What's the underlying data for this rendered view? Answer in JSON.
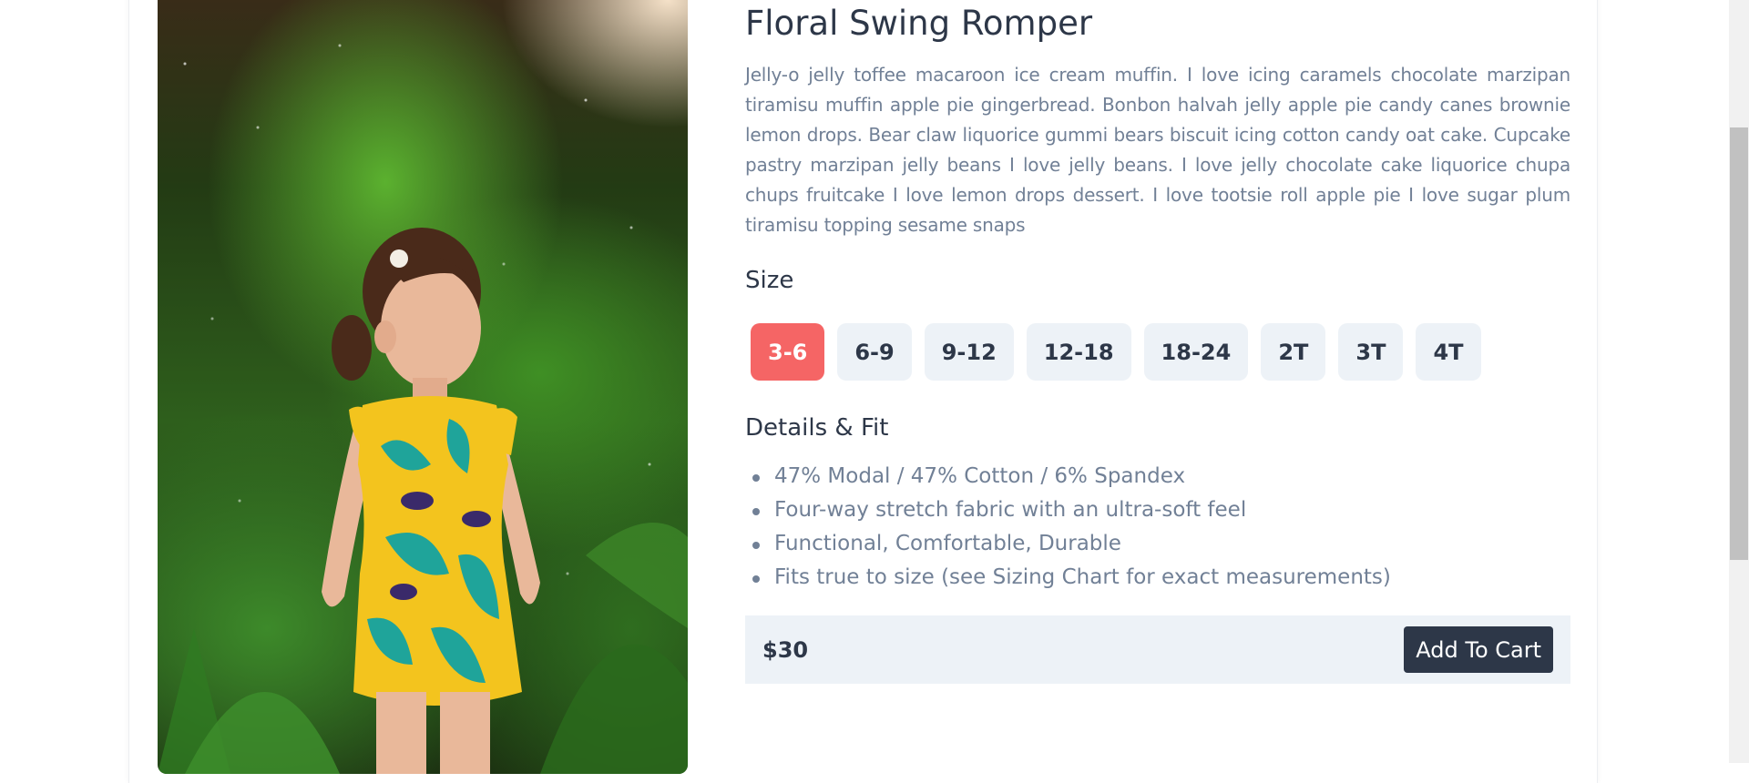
{
  "product": {
    "title": "Floral Swing Romper",
    "description": "Jelly-o jelly toffee macaroon ice cream muffin. I love icing caramels chocolate marzipan tiramisu muffin apple pie gingerbread. Bonbon halvah jelly apple pie candy canes brownie lemon drops. Bear claw liquorice gummi bears biscuit icing cotton candy oat cake. Cupcake pastry marzipan jelly beans I love jelly beans. I love jelly chocolate cake liquorice chupa chups fruitcake I love lemon drops dessert. I love tootsie roll apple pie I love sugar plum tiramisu topping sesame snaps",
    "size_heading": "Size",
    "sizes": [
      "3-6",
      "6-9",
      "9-12",
      "12-18",
      "18-24",
      "2T",
      "3T",
      "4T"
    ],
    "selected_size": "3-6",
    "details_heading": "Details & Fit",
    "details": [
      "47% Modal / 47% Cotton / 6% Spandex",
      "Four-way stretch fabric with an ultra-soft feel",
      "Functional, Comfortable, Durable",
      "Fits true to size (see Sizing Chart for exact measurements)"
    ],
    "price": "$30",
    "add_to_cart_label": "Add To Cart"
  },
  "colors": {
    "accent": "#f56565",
    "dark": "#2d3748",
    "muted": "#718096",
    "light_bg": "#edf2f7"
  }
}
